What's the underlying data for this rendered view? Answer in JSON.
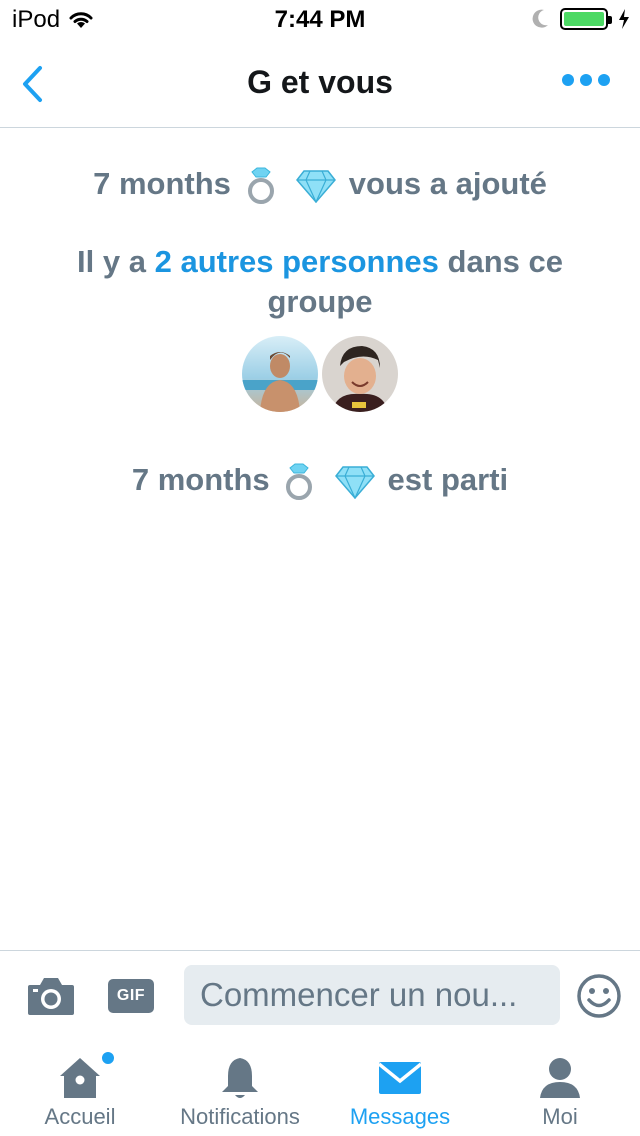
{
  "status_bar": {
    "device": "iPod",
    "time": "7:44 PM",
    "battery_level": 1.0
  },
  "nav": {
    "title": "G et vous"
  },
  "conversation": {
    "event_added": {
      "user": "7 months",
      "emoji": [
        "ring-emoji",
        "gem-emoji"
      ],
      "text": "vous a ajouté"
    },
    "participants": {
      "prefix": "Il y a",
      "link": "2 autres personnes",
      "suffix": "dans ce groupe"
    },
    "avatars": [
      "avatar-person-1",
      "avatar-person-2"
    ],
    "event_left": {
      "user": "7 months",
      "emoji": [
        "ring-emoji",
        "gem-emoji"
      ],
      "text": "est parti"
    }
  },
  "composer": {
    "gif_label": "GIF",
    "placeholder": "Commencer un nou..."
  },
  "tabs": [
    {
      "label": "Accueil",
      "icon": "home-icon",
      "active": false,
      "badge": true
    },
    {
      "label": "Notifications",
      "icon": "bell-icon",
      "active": false
    },
    {
      "label": "Messages",
      "icon": "envelope-icon",
      "active": true
    },
    {
      "label": "Moi",
      "icon": "person-icon",
      "active": false
    }
  ],
  "colors": {
    "accent": "#1da1f2",
    "link": "#1b95e0",
    "muted": "#657786",
    "divider": "#ccd6dd",
    "input_bg": "#e6ecf0"
  }
}
